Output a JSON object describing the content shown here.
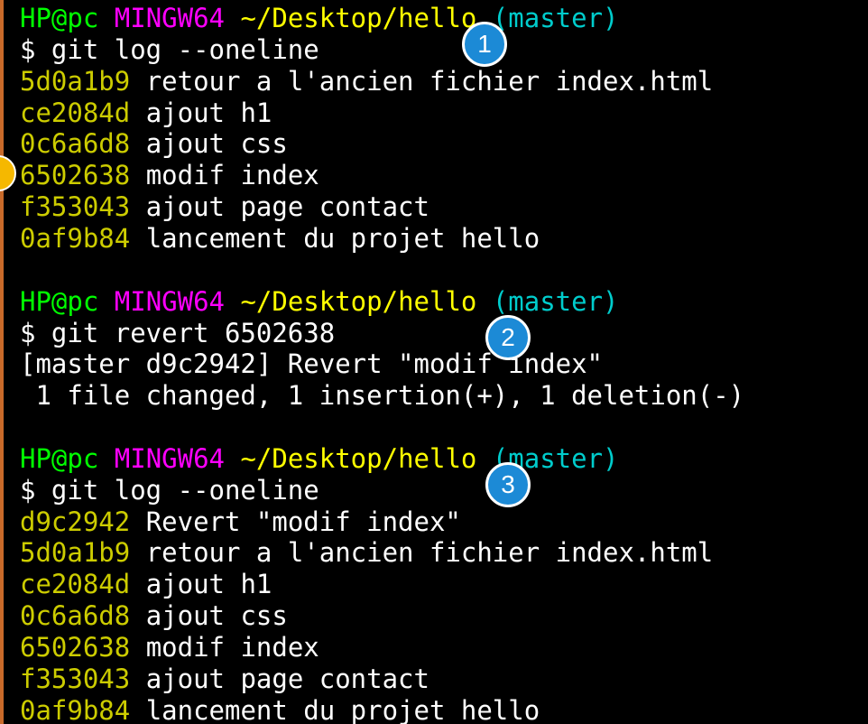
{
  "colors": {
    "background": "#000000",
    "prompt_user": "#00ff00",
    "prompt_shell": "#ff00ff",
    "prompt_path": "#ffff00",
    "prompt_branch": "#00cccc",
    "text": "#ffffff",
    "hash": "#cccc00",
    "badge": "#1c8ad6",
    "badge_partial": "#f5b800"
  },
  "lines": [
    {
      "type": "prompt",
      "user": "HP@pc",
      "shell": "MINGW64",
      "path": "~/Desktop/hello",
      "branch": "(master)"
    },
    {
      "type": "command",
      "text": "$ git log --oneline"
    },
    {
      "type": "commit",
      "hash": "5d0a1b9",
      "message": "retour a l'ancien fichier index.html"
    },
    {
      "type": "commit",
      "hash": "ce2084d",
      "message": "ajout h1"
    },
    {
      "type": "commit",
      "hash": "0c6a6d8",
      "message": "ajout css"
    },
    {
      "type": "commit",
      "hash": "6502638",
      "message": "modif index"
    },
    {
      "type": "commit",
      "hash": "f353043",
      "message": "ajout page contact"
    },
    {
      "type": "commit",
      "hash": "0af9b84",
      "message": "lancement du projet hello"
    },
    {
      "type": "blank"
    },
    {
      "type": "prompt",
      "user": "HP@pc",
      "shell": "MINGW64",
      "path": "~/Desktop/hello",
      "branch": "(master)"
    },
    {
      "type": "command",
      "text": "$ git revert 6502638"
    },
    {
      "type": "output",
      "text": "[master d9c2942] Revert \"modif index\""
    },
    {
      "type": "output",
      "text": " 1 file changed, 1 insertion(+), 1 deletion(-)"
    },
    {
      "type": "blank"
    },
    {
      "type": "prompt",
      "user": "HP@pc",
      "shell": "MINGW64",
      "path": "~/Desktop/hello",
      "branch": "(master)"
    },
    {
      "type": "command",
      "text": "$ git log --oneline"
    },
    {
      "type": "commit",
      "hash": "d9c2942",
      "message": "Revert \"modif index\""
    },
    {
      "type": "commit",
      "hash": "5d0a1b9",
      "message": "retour a l'ancien fichier index.html"
    },
    {
      "type": "commit",
      "hash": "ce2084d",
      "message": "ajout h1"
    },
    {
      "type": "commit",
      "hash": "0c6a6d8",
      "message": "ajout css"
    },
    {
      "type": "commit",
      "hash": "6502638",
      "message": "modif index"
    },
    {
      "type": "commit",
      "hash": "f353043",
      "message": "ajout page contact"
    },
    {
      "type": "commit",
      "hash": "0af9b84",
      "message": "lancement du projet hello"
    }
  ],
  "badges": [
    {
      "label": "1"
    },
    {
      "label": "2"
    },
    {
      "label": "3"
    }
  ]
}
